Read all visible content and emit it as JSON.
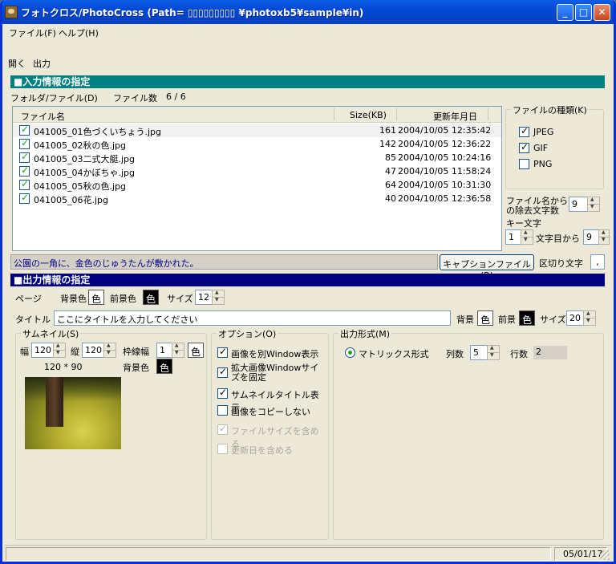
{
  "titlebar": {
    "title": "フォトクロス/PhotoCross (Path=  ▯▯▯▯▯▯▯▯▯  ¥photoxb5¥sample¥in)",
    "min": "_",
    "max": "□",
    "close": "✕"
  },
  "menu": {
    "file": "ファイル(F)",
    "help": "ヘルプ(H)"
  },
  "toolbar": {
    "open": "開く",
    "output": "出力"
  },
  "input_section": {
    "header": "■入力情報の指定",
    "folder_label": "フォルダ/ファイル(D)",
    "count_label": "ファイル数",
    "count_value": "6 / 6",
    "columns": {
      "name": "ファイル名",
      "size": "Size(KB)",
      "date": "更新年月日"
    },
    "files": [
      {
        "name": "041005_01色づくいちょう.jpg",
        "size": "161",
        "date": "2004/10/05 12:35:42",
        "checked": true
      },
      {
        "name": "041005_02秋の色.jpg",
        "size": "142",
        "date": "2004/10/05 12:36:22",
        "checked": true
      },
      {
        "name": "041005_03二式大艇.jpg",
        "size": "85",
        "date": "2004/10/05 10:24:16",
        "checked": true
      },
      {
        "name": "041005_04かぼちゃ.jpg",
        "size": "47",
        "date": "2004/10/05 11:58:24",
        "checked": true
      },
      {
        "name": "041005_05秋の色.jpg",
        "size": "64",
        "date": "2004/10/05 10:31:30",
        "checked": true
      },
      {
        "name": "041005_06花.jpg",
        "size": "40",
        "date": "2004/10/05 12:36:58",
        "checked": true
      }
    ],
    "file_types": {
      "title": "ファイルの種類(K)",
      "jpeg": "JPEG",
      "gif": "GIF",
      "png": "PNG"
    },
    "strip_label_1": "ファイル名から",
    "strip_label_2": "の除去文字数",
    "strip_value": "9",
    "key_label": "キー文字",
    "key_value": "1",
    "from_label": "文字目から",
    "from_value": "9",
    "caption_text": "公園の一角に、金色のじゅうたんが敷かれた。",
    "caption_button": "キャプションファイル(R)",
    "delimiter_label": "区切り文字",
    "delimiter_value": ","
  },
  "output_section": {
    "header": "■出力情報の指定",
    "page_label": "ページ",
    "bg_label": "背景色",
    "color_btn": "色",
    "fg_label": "前景色",
    "size_label": "サイズ",
    "page_size": "12",
    "title_label": "タイトル",
    "title_placeholder": "ここにタイトルを入力してください",
    "title_bg_label": "背景",
    "title_fg_label": "前景",
    "title_size": "20",
    "thumbnail": {
      "title": "サムネイル(S)",
      "width_label": "幅",
      "width_value": "120",
      "height_label": "縦",
      "height_value": "120",
      "border_label": "枠線幅",
      "border_value": "1",
      "dims": "120 * 90",
      "bg_label": "背景色"
    },
    "options": {
      "title": "オプション(O)",
      "items": [
        {
          "label": "画像を別Window表示",
          "checked": true,
          "enabled": true
        },
        {
          "label": "拡大画像Windowサイズを固定",
          "checked": true,
          "enabled": true
        },
        {
          "label": "サムネイルタイトル表示",
          "checked": true,
          "enabled": true
        },
        {
          "label": "画像をコピーしない",
          "checked": false,
          "enabled": true
        },
        {
          "label": "ファイルサイズを含める",
          "checked": true,
          "enabled": false
        },
        {
          "label": "更新日を含める",
          "checked": false,
          "enabled": false
        }
      ]
    },
    "format": {
      "title": "出力形式(M)",
      "matrix_label": "マトリックス形式",
      "cols_label": "列数",
      "cols_value": "5",
      "rows_label": "行数",
      "rows_value": "2"
    }
  },
  "status": {
    "date": "05/01/17"
  }
}
